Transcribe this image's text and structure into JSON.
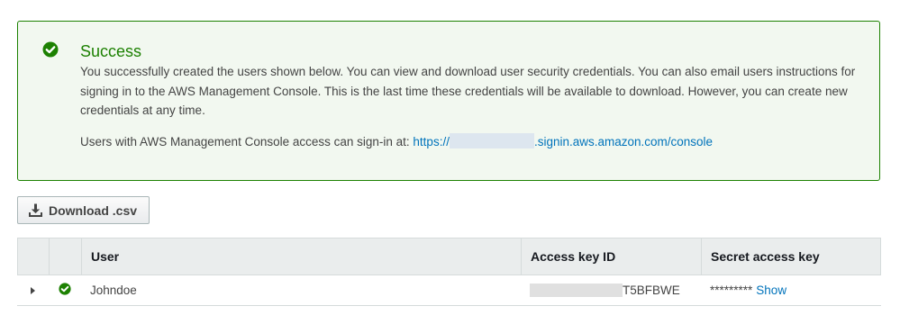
{
  "alert": {
    "title": "Success",
    "message": "You successfully created the users shown below. You can view and download user security credentials. You can also email users instructions for signing in to the AWS Management Console. This is the last time these credentials will be available to download. However, you can create new credentials at any time.",
    "signin_prefix": "Users with AWS Management Console access can sign-in at: ",
    "signin_link_start": "https://",
    "signin_link_end": ".signin.aws.amazon.com/console",
    "color": "#1d8102"
  },
  "toolbar": {
    "download_label": "Download .csv"
  },
  "table": {
    "headers": {
      "user": "User",
      "access_key_id": "Access key ID",
      "secret_access_key": "Secret access key"
    },
    "rows": [
      {
        "user": "Johndoe",
        "access_key_suffix": "T5BFBWE",
        "secret_mask": "*********",
        "show_label": "Show"
      }
    ]
  },
  "colors": {
    "link": "#0073bb",
    "success": "#1d8102"
  }
}
